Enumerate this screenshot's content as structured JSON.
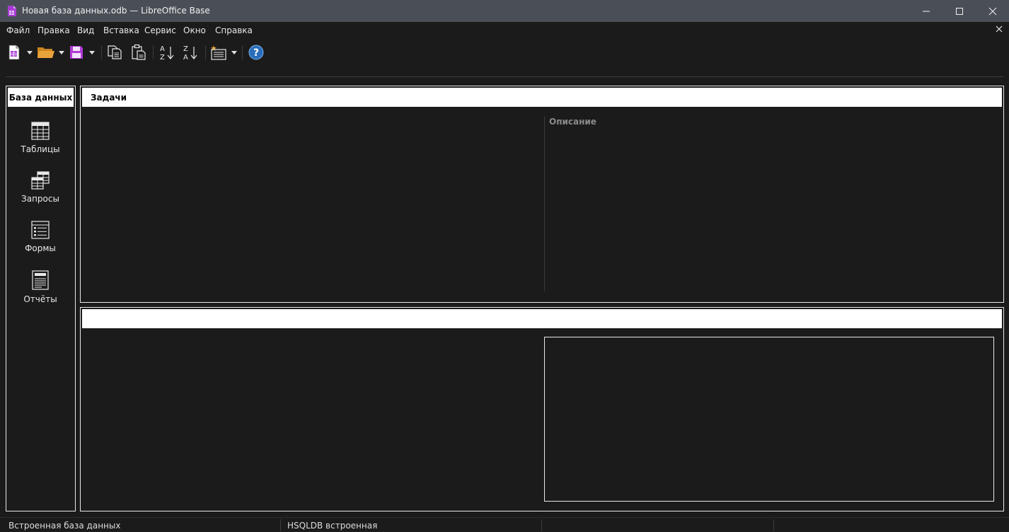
{
  "window": {
    "title": "Новая база данных.odb — LibreOffice Base",
    "controls": [
      "minimize-icon",
      "maximize-icon",
      "close-icon"
    ]
  },
  "menu": {
    "items": [
      "Файл",
      "Правка",
      "Вид",
      "Вставка",
      "Сервис",
      "Окно",
      "Справка"
    ]
  },
  "toolbar": {
    "buttons": [
      "new-document-icon",
      "open-folder-icon",
      "save-icon",
      "copy-icon",
      "paste-icon",
      "sort-ascending-icon",
      "sort-descending-icon",
      "form-wizard-icon",
      "help-icon"
    ]
  },
  "sidebar": {
    "header": "База данных",
    "items": [
      {
        "label": "Таблицы",
        "icon": "table-icon"
      },
      {
        "label": "Запросы",
        "icon": "query-icon"
      },
      {
        "label": "Формы",
        "icon": "form-icon"
      },
      {
        "label": "Отчёты",
        "icon": "report-icon"
      }
    ]
  },
  "tasks": {
    "header": "Задачи",
    "description_label": "Описание"
  },
  "lower_panel": {
    "header": ""
  },
  "status": {
    "left": "Встроенная база данных",
    "engine": "HSQLDB встроенная"
  },
  "colors": {
    "titlebar": "#4a4f57",
    "background": "#1b1b1b",
    "panel_border": "#e9e9e9",
    "header_bg": "#ffffff",
    "help_blue": "#2a6ebb",
    "accent_purple": "#a83bd6",
    "folder_orange": "#e8a33a"
  }
}
